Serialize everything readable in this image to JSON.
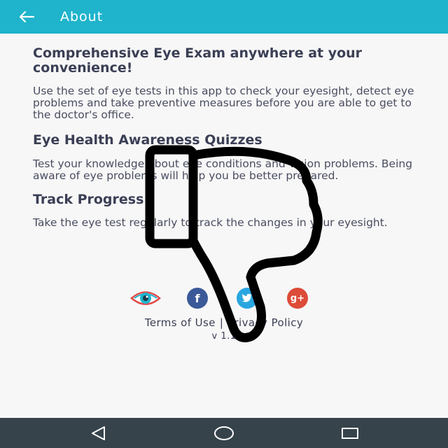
{
  "appbar": {
    "title": "About",
    "back_icon": "arrow-left-icon",
    "background": "#1fb4cc"
  },
  "content": {
    "heading1": "Comprehensive Eye Exam anywhere at your convenience!",
    "para1": "Use the set of eye tests in this app to check your eyesight, detect eye problems and take preventive measures before you are able to get to the doctor's office.",
    "heading2": "Eye Health Awareness Quizzes",
    "para2": "Test your knowledge about eye conditions and vision problems. Being aware of eye problems will help you be better prepared.",
    "heading3": "Track Progress",
    "para3": "Take the eye test regularly to track the changes in your eyesight."
  },
  "social": [
    {
      "icon": "eye-logo-icon"
    },
    {
      "icon": "facebook-icon",
      "glyph": "f",
      "color": "#3b5998"
    },
    {
      "icon": "twitter-icon",
      "color": "#29a6e0"
    },
    {
      "icon": "google-plus-icon",
      "glyph": "g+",
      "color": "#dd4b39"
    }
  ],
  "links": {
    "terms": "Terms of Use",
    "separator": "|",
    "privacy": "Privacy Policy"
  },
  "version": "v 1.1",
  "overlay": {
    "icon": "thumbs-down-icon"
  },
  "navbar": {
    "back_icon": "nav-back-icon",
    "home_icon": "nav-home-icon",
    "recent_icon": "nav-recent-icon",
    "background": "#36434b"
  }
}
